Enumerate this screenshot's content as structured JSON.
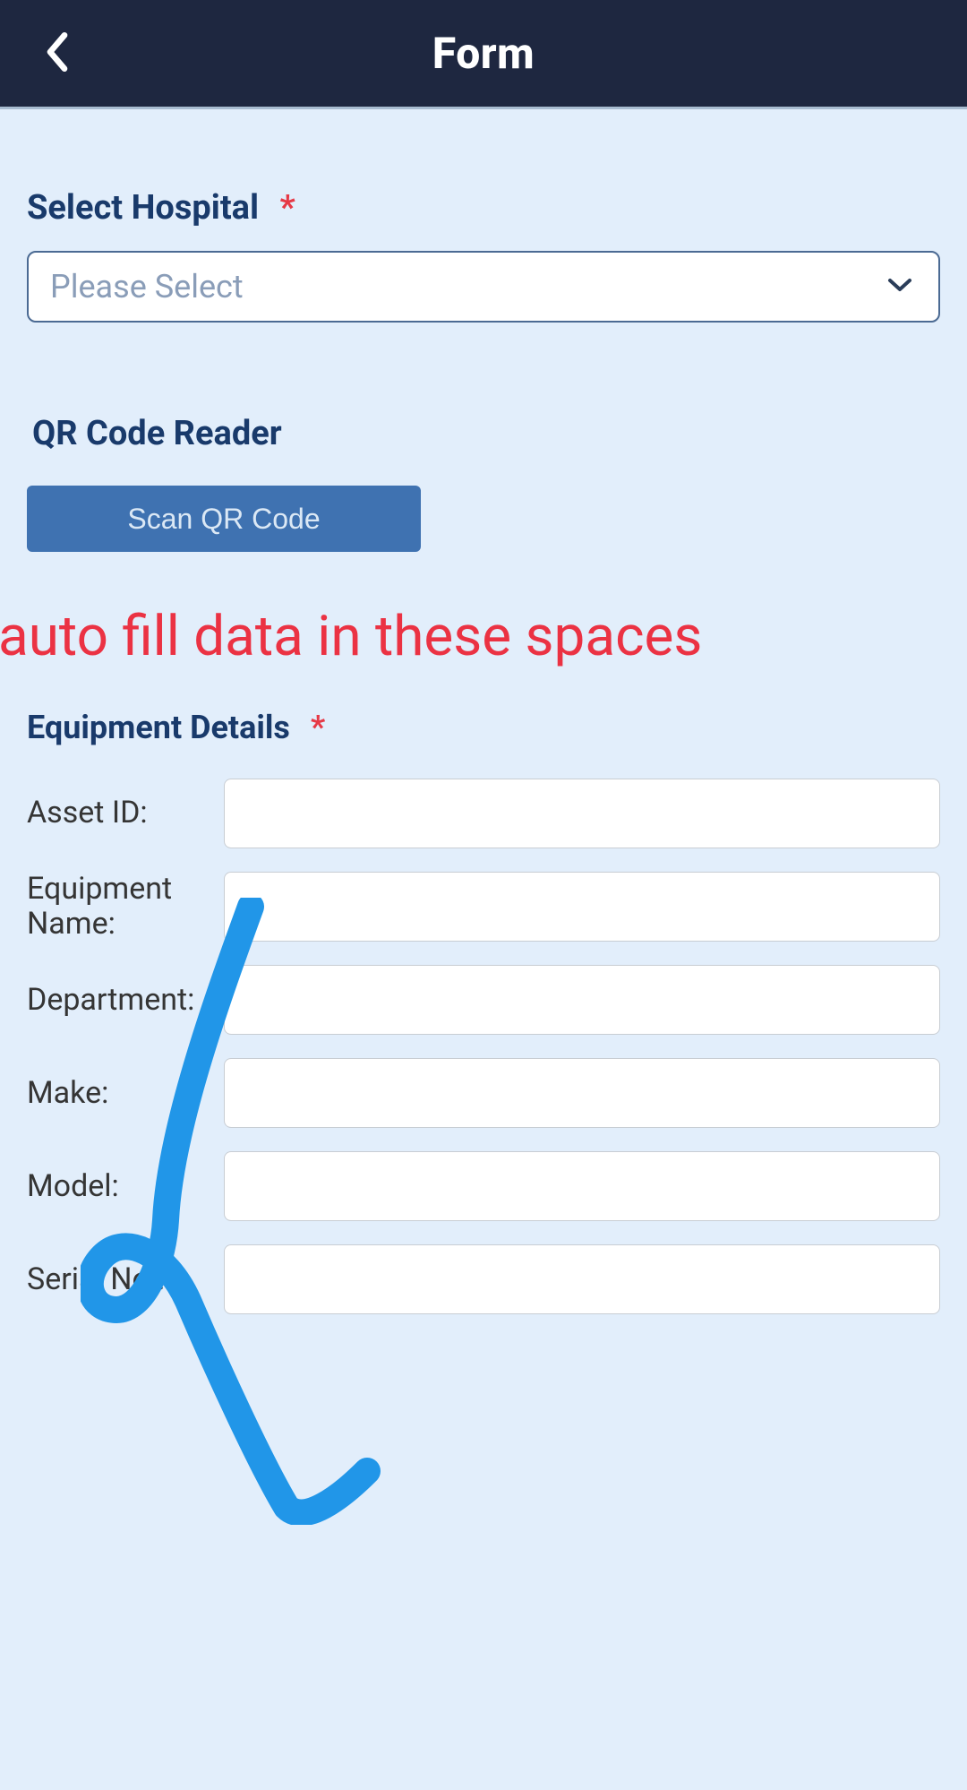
{
  "header": {
    "title": "Form"
  },
  "hospital": {
    "label": "Select Hospital",
    "required_mark": "*",
    "placeholder": "Please Select"
  },
  "qr": {
    "label": "QR Code Reader",
    "button": "Scan QR Code"
  },
  "annotation_text": "auto fill data in these spaces",
  "equipment": {
    "heading": "Equipment Details",
    "required_mark": "*",
    "fields": {
      "asset_id": {
        "label": "Asset ID:",
        "value": ""
      },
      "name": {
        "label": "Equipment Name:",
        "value": ""
      },
      "dept": {
        "label": "Department:",
        "value": ""
      },
      "make": {
        "label": "Make:",
        "value": ""
      },
      "model": {
        "label": "Model:",
        "value": ""
      },
      "serial": {
        "label": "Serial No.:",
        "value": ""
      }
    }
  },
  "colors": {
    "header_bg": "#1e2740",
    "page_bg": "#e2eefb",
    "label": "#193a6b",
    "accent": "#3f72b1",
    "required": "#e63946",
    "annotation": "#eb3243",
    "doodle": "#2196e8"
  }
}
